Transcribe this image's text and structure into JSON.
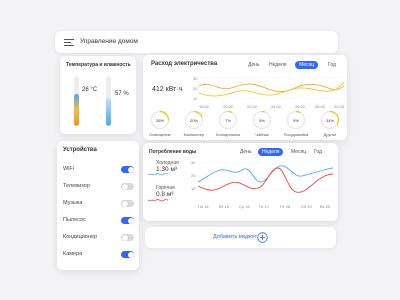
{
  "header": {
    "title": "Управление домом",
    "menu_icon": "menu-icon"
  },
  "temp_card": {
    "title": "Температура и влажность",
    "temperature": "26 °C",
    "humidity": "57 %",
    "temp_fill": 0.65,
    "hum_fill": 0.57
  },
  "devices": {
    "title": "Устройства",
    "items": [
      {
        "label": "WiFi",
        "on": true
      },
      {
        "label": "Телевизор",
        "on": false
      },
      {
        "label": "Музыка",
        "on": false
      },
      {
        "label": "Пылесос",
        "on": true
      },
      {
        "label": "Кондиционер",
        "on": false
      },
      {
        "label": "Камера",
        "on": true
      }
    ]
  },
  "electricity": {
    "title": "Расход электричества",
    "tabs": [
      "День",
      "Неделя",
      "Месяц",
      "Год"
    ],
    "active_tab": 2,
    "total": "412 кВт·ч",
    "x_labels": [
      "18.02",
      "20.02",
      "22.02",
      "24.02",
      "26.02",
      "28.02",
      "02.03"
    ],
    "y_ticks": [
      "30",
      "20",
      "10"
    ],
    "gauges": [
      {
        "percent": "26%",
        "value": 26,
        "label": "Освещение"
      },
      {
        "percent": "20%",
        "value": 20,
        "label": "Компьютер"
      },
      {
        "percent": "7%",
        "value": 7,
        "label": "Холодильник"
      },
      {
        "percent": "5%",
        "value": 5,
        "label": "Чайник"
      },
      {
        "percent": "9%",
        "value": 9,
        "label": "Посудомойка"
      },
      {
        "percent": "34%",
        "value": 34,
        "label": "Другое"
      }
    ]
  },
  "water": {
    "title": "Потребление воды",
    "tabs": [
      "День",
      "Неделя",
      "Месяц",
      "Год"
    ],
    "active_tab": 1,
    "cold_label": "Холодная",
    "cold_value": "1.30 м³",
    "hot_label": "Горячая",
    "hot_value": "0.8 м³",
    "x_labels": [
      "Пн 14",
      "Вт 15",
      "Ср 16",
      "Чт 17",
      "Пт 18",
      "Сб 19",
      "Вс 20"
    ],
    "y_ticks": [
      "30",
      "20",
      "10"
    ]
  },
  "add_widget": {
    "label": "Добавить виджет"
  },
  "colors": {
    "accent": "#3366ff",
    "yellow": "#f5c400",
    "orange": "#f0a020",
    "cold": "#4aa8f0",
    "hot": "#ef4444"
  }
}
